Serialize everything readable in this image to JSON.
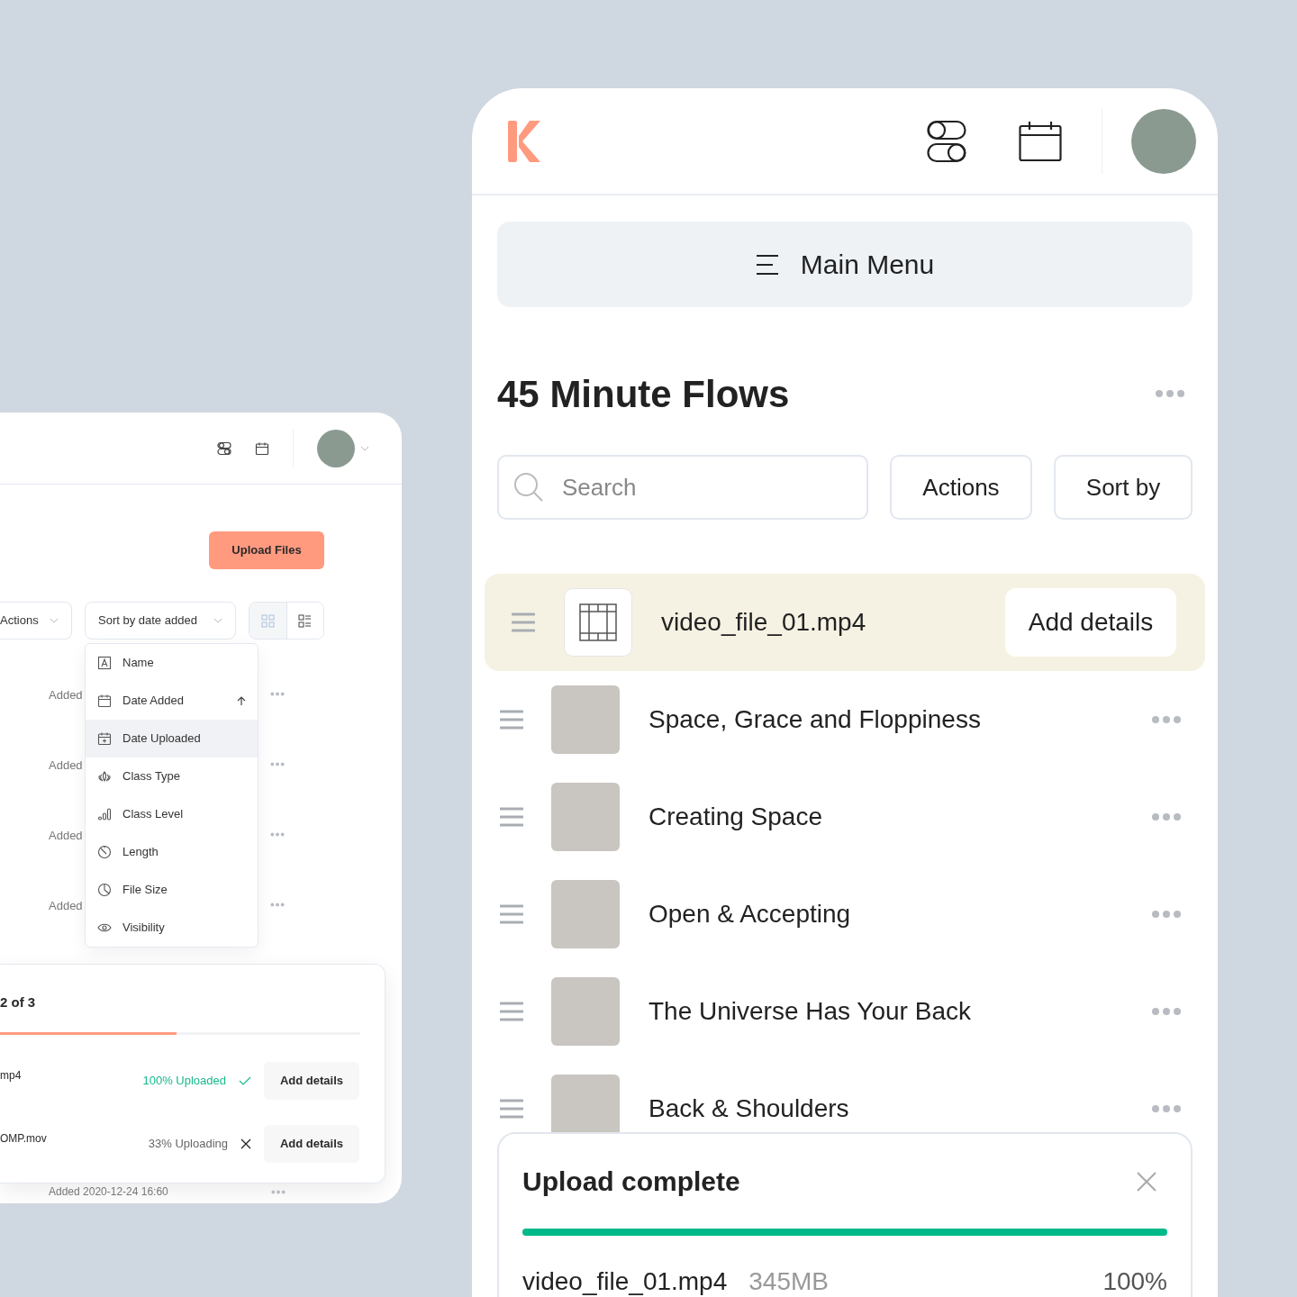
{
  "left_panel": {
    "upload_button": "Upload Files",
    "actions_button": "Actions",
    "sort_button": "Sort by date added",
    "view_toggle": [
      {
        "kind": "grid",
        "selected": true
      },
      {
        "kind": "list",
        "selected": false
      }
    ],
    "rows": [
      "Added",
      "Added",
      "Added",
      "Added"
    ],
    "sort_menu": [
      {
        "kind": "name",
        "label": "Name",
        "selected": false,
        "sorted": false
      },
      {
        "kind": "date_added",
        "label": "Date Added",
        "selected": false,
        "sorted": true
      },
      {
        "kind": "date_uploaded",
        "label": "Date Uploaded",
        "selected": true,
        "sorted": false
      },
      {
        "kind": "class_type",
        "label": "Class Type",
        "selected": false,
        "sorted": false
      },
      {
        "kind": "class_level",
        "label": "Class Level",
        "selected": false,
        "sorted": false
      },
      {
        "kind": "length",
        "label": "Length",
        "selected": false,
        "sorted": false
      },
      {
        "kind": "file_size",
        "label": "File Size",
        "selected": false,
        "sorted": false
      },
      {
        "kind": "visibility",
        "label": "Visibility",
        "selected": false,
        "sorted": false
      }
    ],
    "upload_card": {
      "title": "2 of 3",
      "level": 0.49,
      "files": [
        {
          "name": "mp4",
          "status": "100% Uploaded",
          "complete": true,
          "button": "Add details"
        },
        {
          "name": "OMP.mov",
          "status": "33% Uploading",
          "complete": false,
          "button": "Add details"
        }
      ]
    },
    "footer_row": "Added 2020-12-24 16:60"
  },
  "right_panel": {
    "menu_button": "Main Menu",
    "title": "45 Minute Flows",
    "search": {
      "placeholder": "Search"
    },
    "actions_button": "Actions",
    "sort_button": "Sort by",
    "new_file": {
      "name": "video_file_01.mp4",
      "button": "Add details"
    },
    "classes": [
      "Space, Grace and Floppiness",
      "Creating Space",
      "Open & Accepting",
      "The Universe Has Your Back",
      "Back & Shoulders"
    ],
    "toast": {
      "title": "Upload complete",
      "level": 1,
      "file_name": "video_file_01.mp4",
      "file_size": "345MB",
      "percent": "100%"
    }
  }
}
